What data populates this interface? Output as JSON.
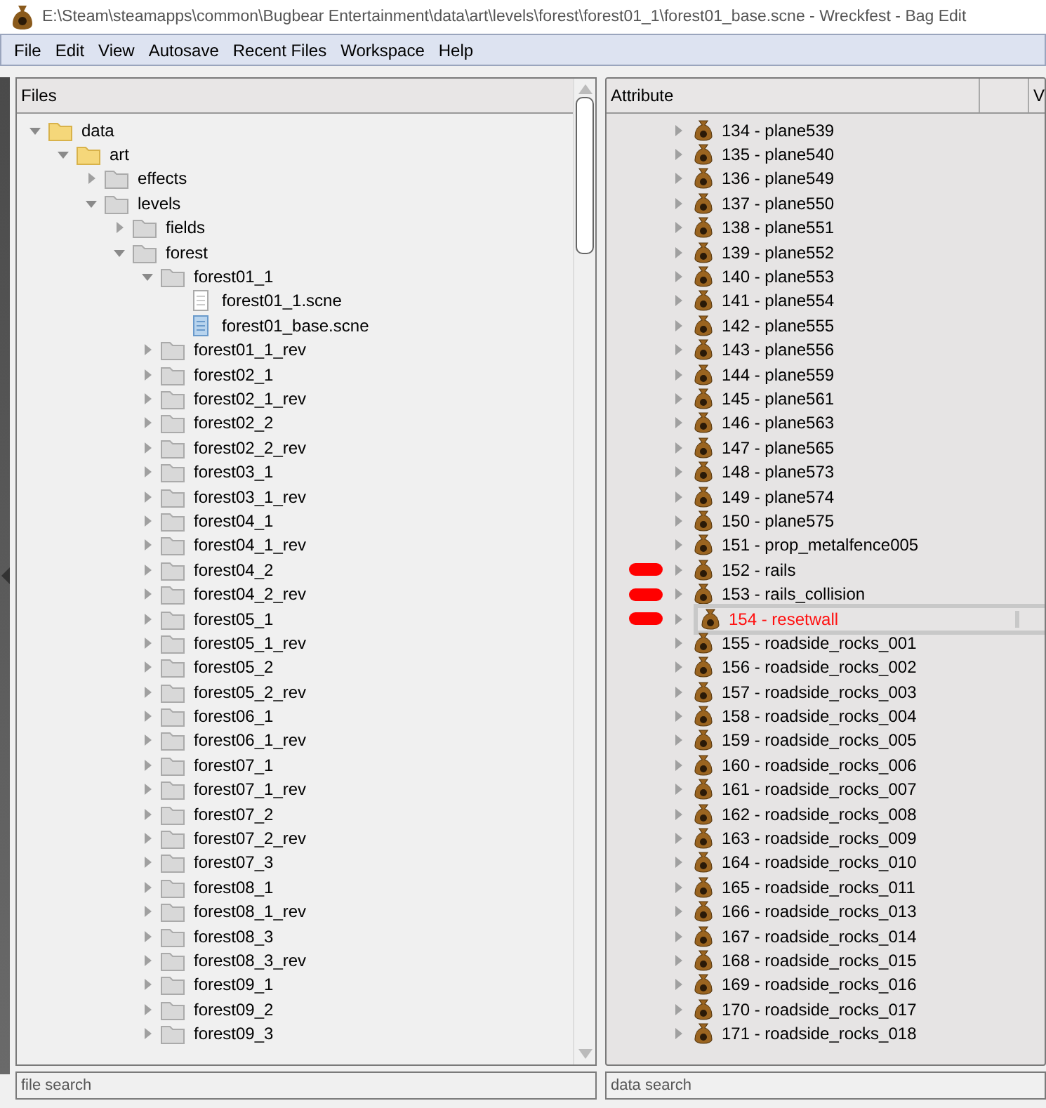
{
  "window": {
    "title": "E:\\Steam\\steamapps\\common\\Bugbear Entertainment\\data\\art\\levels\\forest\\forest01_1\\forest01_base.scne - Wreckfest - Bag Edit"
  },
  "menu": [
    "File",
    "Edit",
    "View",
    "Autosave",
    "Recent Files",
    "Workspace",
    "Help"
  ],
  "files_panel": {
    "header": "Files",
    "tree": [
      {
        "label": "data",
        "kind": "folder",
        "expanded": true,
        "children": [
          {
            "label": "art",
            "kind": "folder",
            "expanded": true,
            "children": [
              {
                "label": "effects",
                "kind": "folder",
                "expanded": false
              },
              {
                "label": "levels",
                "kind": "folder",
                "expanded": true,
                "children": [
                  {
                    "label": "fields",
                    "kind": "folder",
                    "expanded": false
                  },
                  {
                    "label": "forest",
                    "kind": "folder",
                    "expanded": true,
                    "children": [
                      {
                        "label": "forest01_1",
                        "kind": "folder",
                        "expanded": true,
                        "children": [
                          {
                            "label": "forest01_1.scne",
                            "kind": "file"
                          },
                          {
                            "label": "forest01_base.scne",
                            "kind": "bluefile"
                          }
                        ]
                      },
                      {
                        "label": "forest01_1_rev",
                        "kind": "folder",
                        "expanded": false
                      },
                      {
                        "label": "forest02_1",
                        "kind": "folder",
                        "expanded": false
                      },
                      {
                        "label": "forest02_1_rev",
                        "kind": "folder",
                        "expanded": false
                      },
                      {
                        "label": "forest02_2",
                        "kind": "folder",
                        "expanded": false
                      },
                      {
                        "label": "forest02_2_rev",
                        "kind": "folder",
                        "expanded": false
                      },
                      {
                        "label": "forest03_1",
                        "kind": "folder",
                        "expanded": false
                      },
                      {
                        "label": "forest03_1_rev",
                        "kind": "folder",
                        "expanded": false
                      },
                      {
                        "label": "forest04_1",
                        "kind": "folder",
                        "expanded": false
                      },
                      {
                        "label": "forest04_1_rev",
                        "kind": "folder",
                        "expanded": false
                      },
                      {
                        "label": "forest04_2",
                        "kind": "folder",
                        "expanded": false
                      },
                      {
                        "label": "forest04_2_rev",
                        "kind": "folder",
                        "expanded": false
                      },
                      {
                        "label": "forest05_1",
                        "kind": "folder",
                        "expanded": false
                      },
                      {
                        "label": "forest05_1_rev",
                        "kind": "folder",
                        "expanded": false
                      },
                      {
                        "label": "forest05_2",
                        "kind": "folder",
                        "expanded": false
                      },
                      {
                        "label": "forest05_2_rev",
                        "kind": "folder",
                        "expanded": false
                      },
                      {
                        "label": "forest06_1",
                        "kind": "folder",
                        "expanded": false
                      },
                      {
                        "label": "forest06_1_rev",
                        "kind": "folder",
                        "expanded": false
                      },
                      {
                        "label": "forest07_1",
                        "kind": "folder",
                        "expanded": false
                      },
                      {
                        "label": "forest07_1_rev",
                        "kind": "folder",
                        "expanded": false
                      },
                      {
                        "label": "forest07_2",
                        "kind": "folder",
                        "expanded": false
                      },
                      {
                        "label": "forest07_2_rev",
                        "kind": "folder",
                        "expanded": false
                      },
                      {
                        "label": "forest07_3",
                        "kind": "folder",
                        "expanded": false
                      },
                      {
                        "label": "forest08_1",
                        "kind": "folder",
                        "expanded": false
                      },
                      {
                        "label": "forest08_1_rev",
                        "kind": "folder",
                        "expanded": false
                      },
                      {
                        "label": "forest08_3",
                        "kind": "folder",
                        "expanded": false
                      },
                      {
                        "label": "forest08_3_rev",
                        "kind": "folder",
                        "expanded": false
                      },
                      {
                        "label": "forest09_1",
                        "kind": "folder",
                        "expanded": false
                      },
                      {
                        "label": "forest09_2",
                        "kind": "folder",
                        "expanded": false
                      },
                      {
                        "label": "forest09_3",
                        "kind": "folder",
                        "expanded": false
                      }
                    ]
                  }
                ]
              }
            ]
          }
        ]
      }
    ],
    "search": {
      "placeholder": "file search"
    }
  },
  "data_panel": {
    "columns": [
      "Attribute",
      "V"
    ],
    "rows": [
      {
        "label": "134 - plane539",
        "marked": false,
        "selected": false
      },
      {
        "label": "135 - plane540",
        "marked": false,
        "selected": false
      },
      {
        "label": "136 - plane549",
        "marked": false,
        "selected": false
      },
      {
        "label": "137 - plane550",
        "marked": false,
        "selected": false
      },
      {
        "label": "138 - plane551",
        "marked": false,
        "selected": false
      },
      {
        "label": "139 - plane552",
        "marked": false,
        "selected": false
      },
      {
        "label": "140 - plane553",
        "marked": false,
        "selected": false
      },
      {
        "label": "141 - plane554",
        "marked": false,
        "selected": false
      },
      {
        "label": "142 - plane555",
        "marked": false,
        "selected": false
      },
      {
        "label": "143 - plane556",
        "marked": false,
        "selected": false
      },
      {
        "label": "144 - plane559",
        "marked": false,
        "selected": false
      },
      {
        "label": "145 - plane561",
        "marked": false,
        "selected": false
      },
      {
        "label": "146 - plane563",
        "marked": false,
        "selected": false
      },
      {
        "label": "147 - plane565",
        "marked": false,
        "selected": false
      },
      {
        "label": "148 - plane573",
        "marked": false,
        "selected": false
      },
      {
        "label": "149 - plane574",
        "marked": false,
        "selected": false
      },
      {
        "label": "150 - plane575",
        "marked": false,
        "selected": false
      },
      {
        "label": "151 - prop_metalfence005",
        "marked": false,
        "selected": false
      },
      {
        "label": "152 - rails",
        "marked": true,
        "selected": false
      },
      {
        "label": "153 - rails_collision",
        "marked": true,
        "selected": false
      },
      {
        "label": "154 - resetwall",
        "marked": true,
        "selected": true
      },
      {
        "label": "155 - roadside_rocks_001",
        "marked": false,
        "selected": false
      },
      {
        "label": "156 - roadside_rocks_002",
        "marked": false,
        "selected": false
      },
      {
        "label": "157 - roadside_rocks_003",
        "marked": false,
        "selected": false
      },
      {
        "label": "158 - roadside_rocks_004",
        "marked": false,
        "selected": false
      },
      {
        "label": "159 - roadside_rocks_005",
        "marked": false,
        "selected": false
      },
      {
        "label": "160 - roadside_rocks_006",
        "marked": false,
        "selected": false
      },
      {
        "label": "161 - roadside_rocks_007",
        "marked": false,
        "selected": false
      },
      {
        "label": "162 - roadside_rocks_008",
        "marked": false,
        "selected": false
      },
      {
        "label": "163 - roadside_rocks_009",
        "marked": false,
        "selected": false
      },
      {
        "label": "164 - roadside_rocks_010",
        "marked": false,
        "selected": false
      },
      {
        "label": "165 - roadside_rocks_011",
        "marked": false,
        "selected": false
      },
      {
        "label": "166 - roadside_rocks_013",
        "marked": false,
        "selected": false
      },
      {
        "label": "167 - roadside_rocks_014",
        "marked": false,
        "selected": false
      },
      {
        "label": "168 - roadside_rocks_015",
        "marked": false,
        "selected": false
      },
      {
        "label": "169 - roadside_rocks_016",
        "marked": false,
        "selected": false
      },
      {
        "label": "170 - roadside_rocks_017",
        "marked": false,
        "selected": false
      },
      {
        "label": "171 - roadside_rocks_018",
        "marked": false,
        "selected": false
      }
    ],
    "search": {
      "placeholder": "data search"
    }
  }
}
